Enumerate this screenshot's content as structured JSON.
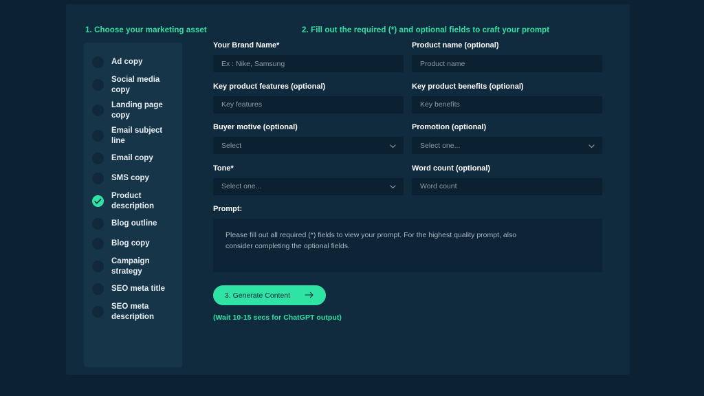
{
  "steps": {
    "left_heading": "1. Choose your marketing asset",
    "right_heading": "2. Fill out the required (*) and optional fields to craft your prompt"
  },
  "sidebar": {
    "items": [
      {
        "label": "Ad copy",
        "selected": false
      },
      {
        "label": "Social media copy",
        "selected": false
      },
      {
        "label": "Landing page copy",
        "selected": false
      },
      {
        "label": "Email subject line",
        "selected": false
      },
      {
        "label": "Email copy",
        "selected": false
      },
      {
        "label": "SMS copy",
        "selected": false
      },
      {
        "label": "Product description",
        "selected": true
      },
      {
        "label": "Blog outline",
        "selected": false
      },
      {
        "label": "Blog copy",
        "selected": false
      },
      {
        "label": "Campaign strategy",
        "selected": false
      },
      {
        "label": "SEO meta title",
        "selected": false
      },
      {
        "label": "SEO meta description",
        "selected": false
      }
    ]
  },
  "form": {
    "brand_name": {
      "label": "Your Brand Name*",
      "placeholder": "Ex : Nike, Samsung",
      "value": ""
    },
    "product_name": {
      "label": "Product name (optional)",
      "placeholder": "Product name",
      "value": ""
    },
    "key_features": {
      "label": "Key product features (optional)",
      "placeholder": "Key features",
      "value": ""
    },
    "key_benefits": {
      "label": "Key product benefits (optional)",
      "placeholder": "Key benefits",
      "value": ""
    },
    "buyer_motive": {
      "label": "Buyer motive (optional)",
      "selected": "Select"
    },
    "promotion": {
      "label": "Promotion (optional)",
      "selected": "Select one..."
    },
    "tone": {
      "label": "Tone*",
      "selected": "Select one..."
    },
    "word_count": {
      "label": "Word count (optional)",
      "placeholder": "Word count",
      "value": ""
    }
  },
  "prompt": {
    "label": "Prompt:",
    "text": "Please fill out all required (*) fields to view your prompt. For the highest quality prompt, also consider completing the optional fields."
  },
  "actions": {
    "generate_label": "3. Generate Content",
    "generate_icon": "arrow-right-icon",
    "wait_note": "(Wait 10-15 secs for ChatGPT output)"
  },
  "colors": {
    "page_bg": "#0c2233",
    "card_bg": "#102a3e",
    "sidebar_bg": "#173549",
    "input_bg": "#0b2132",
    "accent": "#2fe3a4",
    "label_text": "#ffffff",
    "placeholder_text": "#8c9aa6"
  }
}
